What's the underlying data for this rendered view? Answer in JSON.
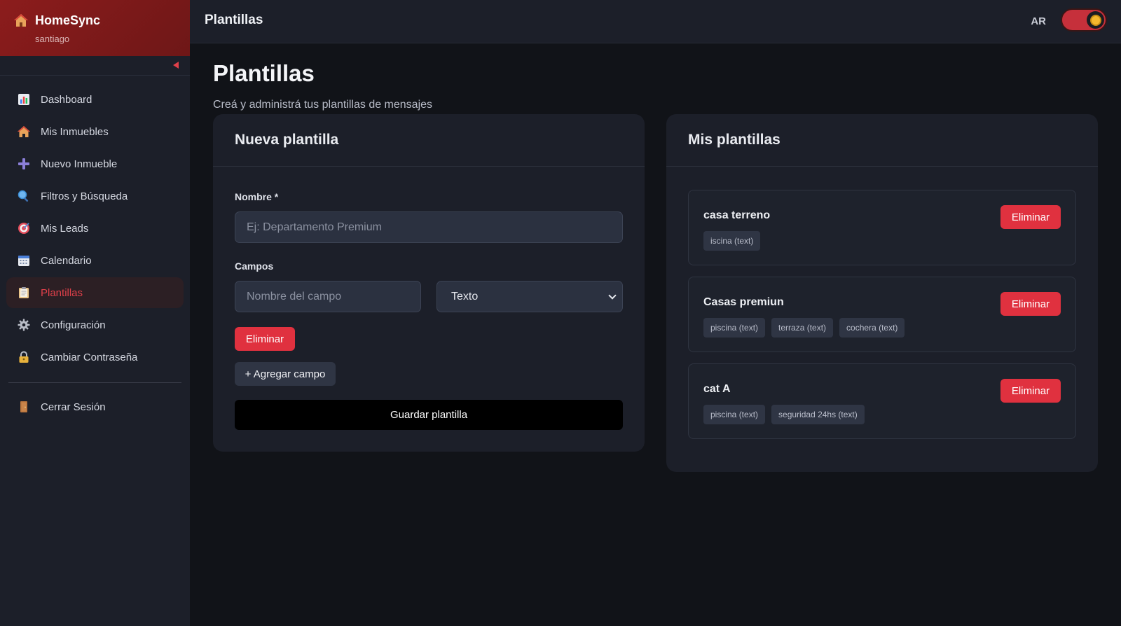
{
  "app": {
    "name": "HomeSync",
    "user": "santiago"
  },
  "sidebar": {
    "items": [
      {
        "label": "Dashboard",
        "icon": "chart-icon"
      },
      {
        "label": "Mis Inmuebles",
        "icon": "house-icon"
      },
      {
        "label": "Nuevo Inmueble",
        "icon": "plus-icon"
      },
      {
        "label": "Filtros y Búsqueda",
        "icon": "magnifier-icon"
      },
      {
        "label": "Mis Leads",
        "icon": "target-icon"
      },
      {
        "label": "Calendario",
        "icon": "calendar-icon"
      },
      {
        "label": "Plantillas",
        "icon": "clipboard-icon",
        "active": true
      },
      {
        "label": "Configuración",
        "icon": "gear-icon"
      },
      {
        "label": "Cambiar Contraseña",
        "icon": "lock-icon"
      }
    ],
    "logout": {
      "label": "Cerrar Sesión",
      "icon": "door-icon"
    }
  },
  "topbar": {
    "title": "Plantillas",
    "locale": "AR",
    "theme_toggle": "sun-icon"
  },
  "page": {
    "title": "Plantillas",
    "subtitle": "Creá y administrá tus plantillas de mensajes"
  },
  "new_template": {
    "title": "Nueva plantilla",
    "name_label": "Nombre *",
    "name_placeholder": "Ej: Departamento Premium",
    "fields_label": "Campos",
    "field_name_placeholder": "Nombre del campo",
    "field_type_selected": "Texto",
    "remove_label": "Eliminar",
    "add_field_label": "+ Agregar campo",
    "save_label": "Guardar plantilla"
  },
  "my_templates": {
    "title": "Mis plantillas",
    "delete_label": "Eliminar",
    "items": [
      {
        "name": "casa terreno",
        "tags": [
          "iscina (text)"
        ]
      },
      {
        "name": "Casas premiun",
        "tags": [
          "piscina (text)",
          "terraza (text)",
          "cochera (text)"
        ]
      },
      {
        "name": "cat A",
        "tags": [
          "piscina (text)",
          "seguridad 24hs (text)"
        ]
      }
    ]
  },
  "colors": {
    "accent": "#e0313f",
    "sidebar_bg": "#1c1f29",
    "page_bg": "#111318",
    "brand_bg": "#8c1c1c"
  }
}
